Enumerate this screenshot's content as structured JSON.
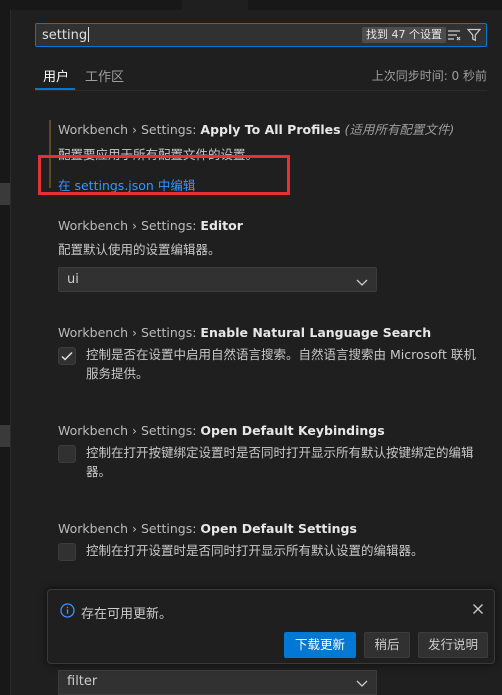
{
  "search": {
    "query": "setting",
    "result_count": "找到 47 个设置"
  },
  "tabs": {
    "user": "用户",
    "workspace": "工作区",
    "sync_status": "上次同步时间: 0 秒前"
  },
  "settings": [
    {
      "prefix": "Workbench › Settings: ",
      "name": "Apply To All Profiles",
      "note": "(适用所有配置文件)",
      "description": "配置要应用于所有配置文件的设置。",
      "link": "在 settings.json 中编辑"
    },
    {
      "prefix": "Workbench › Settings: ",
      "name": "Editor",
      "description": "配置默认使用的设置编辑器。",
      "value": "ui"
    },
    {
      "prefix": "Workbench › Settings: ",
      "name": "Enable Natural Language Search",
      "description": "控制是否在设置中启用自然语言搜索。自然语言搜索由 Microsoft 联机服务提供。",
      "checked": true
    },
    {
      "prefix": "Workbench › Settings: ",
      "name": "Open Default Keybindings",
      "description": "控制在打开按键绑定设置时是否同时打开显示所有默认按键绑定的编辑器。",
      "checked": false
    },
    {
      "prefix": "Workbench › Settings: ",
      "name": "Open Default Settings",
      "description": "控制在打开设置时是否同时打开显示所有默认设置的编辑器。",
      "checked": false
    }
  ],
  "bottom_dropdown": {
    "value": "filter"
  },
  "notification": {
    "message": "存在可用更新。",
    "primary_button": "下载更新",
    "later_button": "稍后",
    "notes_button": "发行说明"
  },
  "colors": {
    "accent": "#0078d4",
    "link": "#3794ff",
    "highlight": "#e23232"
  }
}
